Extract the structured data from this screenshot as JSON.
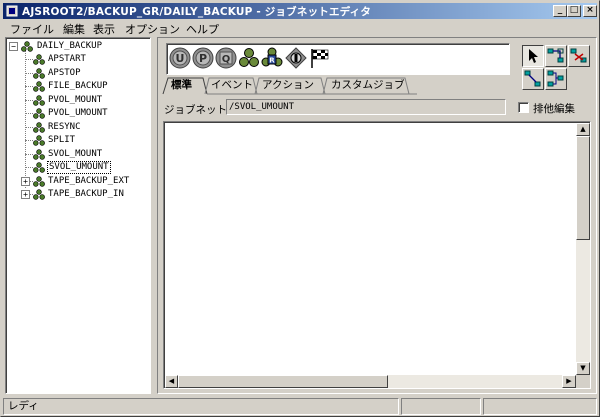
{
  "window": {
    "title": "AJSROOT2/BACKUP_GR/DAILY_BACKUP - ジョブネットエディタ",
    "controls": {
      "minimize": "_",
      "maximize": "□",
      "close": "×"
    }
  },
  "menu": {
    "items": [
      "ファイル",
      "編集",
      "表示",
      "オプション",
      "ヘルプ"
    ]
  },
  "tree": {
    "root": "DAILY_BACKUP",
    "root_expander": "⊟",
    "children": [
      {
        "label": "APSTART",
        "icon": "job-icon"
      },
      {
        "label": "APSTOP",
        "icon": "job-icon"
      },
      {
        "label": "FILE_BACKUP",
        "icon": "job-icon"
      },
      {
        "label": "PVOL_MOUNT",
        "icon": "job-icon"
      },
      {
        "label": "PVOL_UMOUNT",
        "icon": "job-icon"
      },
      {
        "label": "RESYNC",
        "icon": "job-icon"
      },
      {
        "label": "SPLIT",
        "icon": "job-icon"
      },
      {
        "label": "SVOL_MOUNT",
        "icon": "job-icon"
      },
      {
        "label": "SVOL_UMOUNT",
        "icon": "jobnet-icon",
        "selected": true
      },
      {
        "label": "TAPE_BACKUP_EXT",
        "icon": "jobnet-icon",
        "expander": "+"
      },
      {
        "label": "TAPE_BACKUP_IN",
        "icon": "jobnet-icon",
        "expander": "+"
      }
    ]
  },
  "palette": {
    "icons": [
      {
        "name": "unix-job-icon",
        "glyph": "U"
      },
      {
        "name": "pc-job-icon",
        "glyph": "P"
      },
      {
        "name": "queue-job-icon",
        "glyph": "Q"
      },
      {
        "name": "nested-jobnet-icon",
        "glyph": ""
      },
      {
        "name": "remote-jobnet-icon",
        "glyph": "R"
      },
      {
        "name": "or-job-icon",
        "glyph": ""
      },
      {
        "name": "judgment-flag-icon",
        "glyph": ""
      }
    ]
  },
  "tabs": [
    {
      "label": "標準",
      "active": true
    },
    {
      "label": "イベント",
      "active": false
    },
    {
      "label": "アクション",
      "active": false
    },
    {
      "label": "カスタムジョブ",
      "active": false
    }
  ],
  "jobnet": {
    "label": "ジョブネット:",
    "value": "/SVOL_UMOUNT"
  },
  "exclusive_edit": {
    "label": "排他編集",
    "checked": false
  },
  "scrollbars": {
    "up": "▲",
    "down": "▼",
    "left": "◀",
    "right": "▶"
  },
  "status": {
    "text": "レディ"
  },
  "colors": {
    "titlebar_start": "#0a246a",
    "titlebar_end": "#a6caf0",
    "face": "#d4d0c8",
    "job_icon_green": "#4a7a2a",
    "palette_gray": "#909090"
  }
}
